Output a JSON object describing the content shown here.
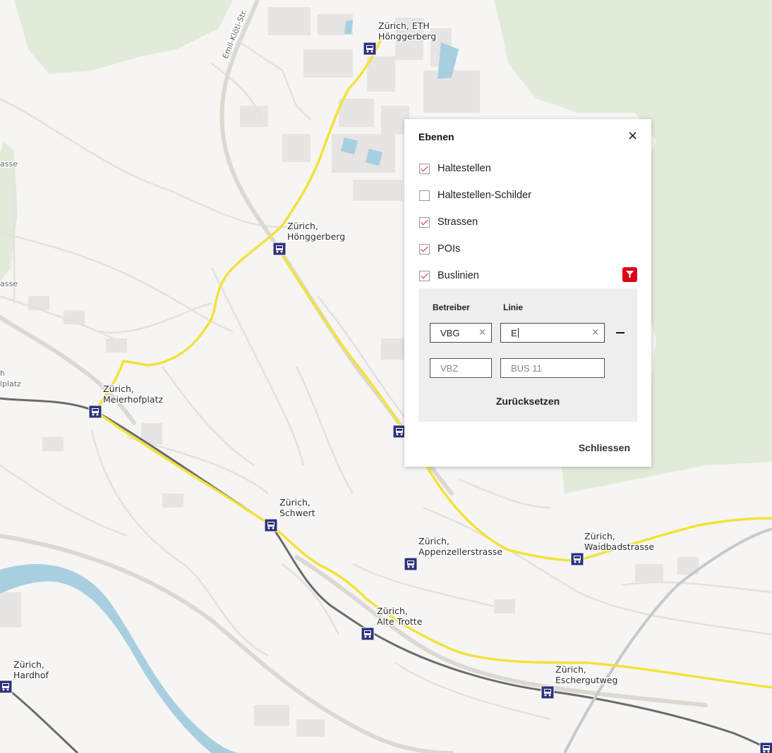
{
  "map": {
    "street_labels": [
      "Emil-Klöti-Str.",
      "asse",
      "asse",
      "h",
      "lplatz"
    ],
    "stops": [
      {
        "id": "eth",
        "line1": "Zürich, ETH",
        "line2": "Hönggerberg"
      },
      {
        "id": "hoenggerberg",
        "line1": "Zürich,",
        "line2": "Hönggerberg"
      },
      {
        "id": "meierhofplatz",
        "line1": "Zürich,",
        "line2": "Meierhofplatz"
      },
      {
        "id": "schwert",
        "line1": "Zürich,",
        "line2": "Schwert"
      },
      {
        "id": "appenzellerstrasse",
        "line1": "Zürich,",
        "line2": "Appenzellerstrasse"
      },
      {
        "id": "waidbadstrasse",
        "line1": "Zürich,",
        "line2": "Waidbadstrasse"
      },
      {
        "id": "alte-trotte",
        "line1": "Zürich,",
        "line2": "Alte Trotte"
      },
      {
        "id": "eschergutweg",
        "line1": "Zürich,",
        "line2": "Eschergutweg"
      },
      {
        "id": "hardhof",
        "line1": "Zürich,",
        "line2": "Hardhof"
      }
    ],
    "colors": {
      "bus_line": "#f3e23a",
      "rail": "#6b6b6b",
      "river": "#a8cfe0",
      "forest": "#e2ebd9",
      "stop_icon": "#2d327d"
    }
  },
  "panel": {
    "title": "Ebenen",
    "close_icon": "×",
    "layers": [
      {
        "label": "Haltestellen",
        "checked": true
      },
      {
        "label": "Haltestellen-Schilder",
        "checked": false
      },
      {
        "label": "Strassen",
        "checked": true
      },
      {
        "label": "POIs",
        "checked": true
      },
      {
        "label": "Buslinien",
        "checked": true
      }
    ],
    "filter_icon": "funnel-icon",
    "filter": {
      "operator_header": "Betreiber",
      "line_header": "Linie",
      "row1_operator": "VBG",
      "row1_line": "E",
      "row2_operator_placeholder": "VBZ",
      "row2_line_placeholder": "BUS 11",
      "clear_icon": "×",
      "reset_label": "Zurücksetzen"
    },
    "close_label": "Schliessen",
    "accent": "#dc0018"
  }
}
